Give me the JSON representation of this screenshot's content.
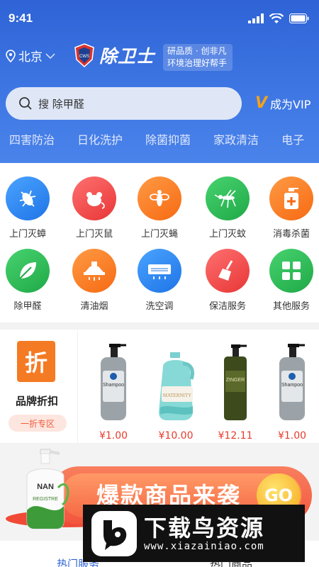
{
  "status_bar": {
    "time": "9:41"
  },
  "header": {
    "location": "北京",
    "brand": "除卫士",
    "logo_badge": "CWS",
    "slogan_line1": "研品质 · 创非凡",
    "slogan_line2": "环境治理好帮手",
    "search_placeholder": "搜   除甲醛",
    "vip_label": "成为VIP",
    "vip_mark": "V"
  },
  "category_tabs": [
    "四害防治",
    "日化洗护",
    "除菌抑菌",
    "家政清洁",
    "电子"
  ],
  "services": [
    {
      "label": "上门灭蟑",
      "icon": "cockroach-icon",
      "color": "#2d86f0"
    },
    {
      "label": "上门灭鼠",
      "icon": "mouse-icon",
      "color": "#f04b4b"
    },
    {
      "label": "上门灭蝇",
      "icon": "fly-icon",
      "color": "#f8771f"
    },
    {
      "label": "上门灭蚊",
      "icon": "mosquito-icon",
      "color": "#2dbb57"
    },
    {
      "label": "消毒杀菌",
      "icon": "disinfect-icon",
      "color": "#f8771f"
    },
    {
      "label": "除甲醛",
      "icon": "leaf-icon",
      "color": "#2dbb57"
    },
    {
      "label": "清油烟",
      "icon": "range-hood-icon",
      "color": "#f8771f"
    },
    {
      "label": "洗空调",
      "icon": "air-conditioner-icon",
      "color": "#2d86f0"
    },
    {
      "label": "保洁服务",
      "icon": "broom-icon",
      "color": "#f04b4b"
    },
    {
      "label": "其他服务",
      "icon": "grid-icon",
      "color": "#2dbb57"
    }
  ],
  "discount": {
    "tag": "折",
    "title": "品牌折扣",
    "pill": "一折专区",
    "products": [
      {
        "name": "Shampoo",
        "price": "¥1.00",
        "icon": "shampoo-bottle-icon"
      },
      {
        "name": "MATERNITY",
        "price": "¥10.00",
        "icon": "detergent-bottle-icon"
      },
      {
        "name": "ZINGER",
        "price": "¥12.11",
        "icon": "green-bottle-icon"
      },
      {
        "name": "Shampoo",
        "price": "¥1.00",
        "icon": "shampoo-bottle-icon"
      }
    ]
  },
  "banner": {
    "headline": "爆款商品来袭",
    "go": "GO",
    "product_label_top": "NAN",
    "product_label_bottom": "REGISTRE"
  },
  "bottom_tabs": [
    "热门服务",
    "热门商品"
  ],
  "watermark": {
    "name": "下载鸟资源",
    "url": "www.xiazainiao.com"
  },
  "colors": {
    "header_blue": "#3a6fe0",
    "accent_orange": "#f57a24",
    "price_red": "#e73b2c"
  }
}
